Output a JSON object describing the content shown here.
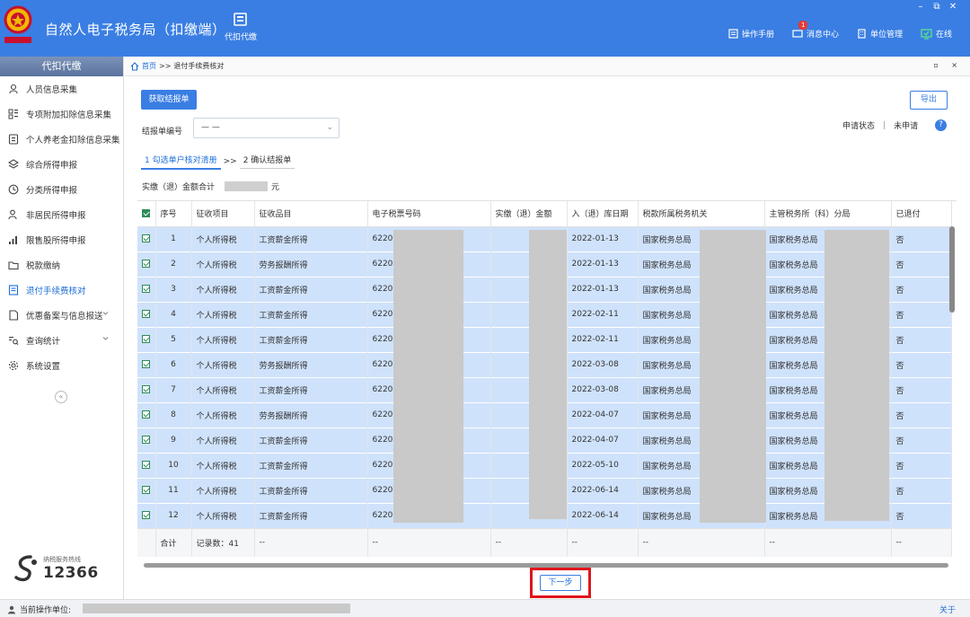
{
  "app": {
    "title": "自然人电子税务局（扣缴端）",
    "module": "代扣代缴",
    "links": {
      "manual": "操作手册",
      "messages": "消息中心",
      "msg_count": "1",
      "unit_mgmt": "单位管理",
      "online": "在线"
    },
    "win_controls": {
      "min": "–",
      "restore": "⧉",
      "close": "✕"
    }
  },
  "sidebar": {
    "header": "代扣代缴",
    "items": [
      {
        "label": "人员信息采集",
        "icon": "person-icon"
      },
      {
        "label": "专项附加扣除信息采集",
        "icon": "grid-icon"
      },
      {
        "label": "个人养老金扣除信息采集",
        "icon": "card-icon"
      },
      {
        "label": "综合所得申报",
        "icon": "layers-icon"
      },
      {
        "label": "分类所得申报",
        "icon": "clock-icon"
      },
      {
        "label": "非居民所得申报",
        "icon": "user-icon"
      },
      {
        "label": "限售股所得申报",
        "icon": "bar-chart-icon"
      },
      {
        "label": "税款缴纳",
        "icon": "folder-icon"
      },
      {
        "label": "退付手续费核对",
        "icon": "doc-icon"
      },
      {
        "label": "优惠备案与信息报送",
        "icon": "doc2-icon"
      },
      {
        "label": "查询统计",
        "icon": "search-list-icon"
      },
      {
        "label": "系统设置",
        "icon": "gear-icon"
      }
    ],
    "collapse": "«",
    "hotline_label": "纳税服务热线",
    "hotline_number": "12366"
  },
  "breadcrumb": {
    "home": "首页",
    "sep": ">>",
    "current": "退付手续费核对",
    "ctrl": "▫ ×"
  },
  "toolbar": {
    "fetch_label": "获取结报单",
    "export_label": "导出"
  },
  "filter": {
    "label": "结报单编号",
    "value": "— —",
    "arrow": "⌄"
  },
  "status": {
    "label": "申请状态",
    "sep": "|",
    "value": "未申请",
    "help": "?"
  },
  "steps": {
    "step1": "1 勾选单户核对清册",
    "sep": ">>",
    "step2": "2 确认结报单"
  },
  "total_line": {
    "label": "实缴（退）金额合计",
    "unit": "元"
  },
  "table": {
    "headers": [
      "序号",
      "征收项目",
      "征收品目",
      "电子税票号码",
      "实缴（退）金额",
      "入（退）库日期",
      "税款所属税务机关",
      "主管税务所（科）分局",
      "已退付"
    ],
    "rows": [
      {
        "no": "1",
        "project": "个人所得税",
        "item": "工资薪金所得",
        "ticket": "6220",
        "date": "2022-01-13",
        "authority": "国家税务总局",
        "branch": "国家税务总局",
        "refunded": "否"
      },
      {
        "no": "2",
        "project": "个人所得税",
        "item": "劳务报酬所得",
        "ticket": "6220",
        "date": "2022-01-13",
        "authority": "国家税务总局",
        "branch": "国家税务总局",
        "refunded": "否"
      },
      {
        "no": "3",
        "project": "个人所得税",
        "item": "工资薪金所得",
        "ticket": "6220",
        "date": "2022-01-13",
        "authority": "国家税务总局",
        "branch": "国家税务总局",
        "refunded": "否"
      },
      {
        "no": "4",
        "project": "个人所得税",
        "item": "工资薪金所得",
        "ticket": "6220",
        "date": "2022-02-11",
        "authority": "国家税务总局",
        "branch": "国家税务总局",
        "refunded": "否"
      },
      {
        "no": "5",
        "project": "个人所得税",
        "item": "工资薪金所得",
        "ticket": "6220",
        "date": "2022-02-11",
        "authority": "国家税务总局",
        "branch": "国家税务总局",
        "refunded": "否"
      },
      {
        "no": "6",
        "project": "个人所得税",
        "item": "劳务报酬所得",
        "ticket": "6220",
        "date": "2022-03-08",
        "authority": "国家税务总局",
        "branch": "国家税务总局",
        "refunded": "否"
      },
      {
        "no": "7",
        "project": "个人所得税",
        "item": "工资薪金所得",
        "ticket": "6220",
        "date": "2022-03-08",
        "authority": "国家税务总局",
        "branch": "国家税务总局",
        "refunded": "否"
      },
      {
        "no": "8",
        "project": "个人所得税",
        "item": "劳务报酬所得",
        "ticket": "6220",
        "date": "2022-04-07",
        "authority": "国家税务总局",
        "branch": "国家税务总局",
        "refunded": "否"
      },
      {
        "no": "9",
        "project": "个人所得税",
        "item": "工资薪金所得",
        "ticket": "6220",
        "date": "2022-04-07",
        "authority": "国家税务总局",
        "branch": "国家税务总局",
        "refunded": "否"
      },
      {
        "no": "10",
        "project": "个人所得税",
        "item": "工资薪金所得",
        "ticket": "6220",
        "date": "2022-05-10",
        "authority": "国家税务总局",
        "branch": "国家税务总局",
        "refunded": "否"
      },
      {
        "no": "11",
        "project": "个人所得税",
        "item": "工资薪金所得",
        "ticket": "6220",
        "date": "2022-06-14",
        "authority": "国家税务总局",
        "branch": "国家税务总局",
        "refunded": "否"
      },
      {
        "no": "12",
        "project": "个人所得税",
        "item": "工资薪金所得",
        "ticket": "6220",
        "date": "2022-06-14",
        "authority": "国家税务总局",
        "branch": "国家税务总局",
        "refunded": "否"
      }
    ],
    "footer": {
      "total": "合计",
      "count": "记录数：41",
      "dash": "--"
    }
  },
  "next_label": "下一步",
  "statusbar": {
    "current_unit": "当前操作单位:",
    "about": "关于"
  },
  "colors": {
    "primary": "#3a7ee3",
    "row_selected": "#cfe2fb",
    "highlight": "#e0161b"
  }
}
